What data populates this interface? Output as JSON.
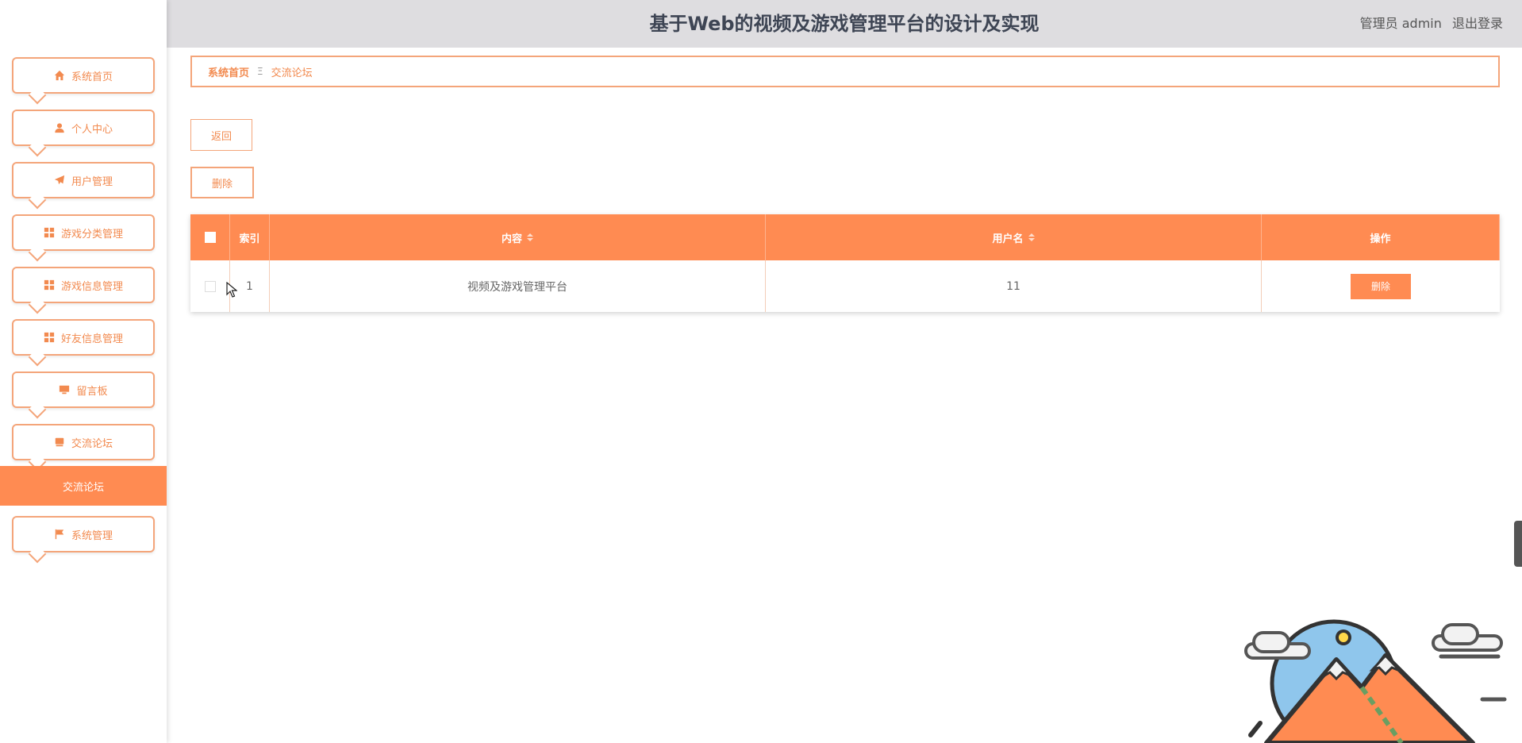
{
  "header": {
    "title": "基于Web的视频及游戏管理平台的设计及实现",
    "user": "管理员 admin",
    "logout": "退出登录"
  },
  "sidebar": {
    "items": [
      {
        "label": "系统首页",
        "icon": "home-icon"
      },
      {
        "label": "个人中心",
        "icon": "person-icon"
      },
      {
        "label": "用户管理",
        "icon": "paper-plane-icon"
      },
      {
        "label": "游戏分类管理",
        "icon": "grid-icon"
      },
      {
        "label": "游戏信息管理",
        "icon": "grid-icon"
      },
      {
        "label": "好友信息管理",
        "icon": "grid-icon"
      },
      {
        "label": "留言板",
        "icon": "monitor-icon"
      },
      {
        "label": "交流论坛",
        "icon": "forum-icon"
      }
    ],
    "active_sub": "交流论坛",
    "last_item": {
      "label": "系统管理",
      "icon": "flag-icon"
    }
  },
  "breadcrumb": {
    "home": "系统首页",
    "separator": "Ξ",
    "current": "交流论坛"
  },
  "buttons": {
    "back": "返回",
    "delete": "删除"
  },
  "table": {
    "columns": [
      "索引",
      "内容",
      "用户名",
      "操作"
    ],
    "rows": [
      {
        "index": "1",
        "content": "视频及游戏管理平台",
        "username": "11",
        "action": "删除"
      }
    ]
  },
  "colors": {
    "accent": "#ff8b52",
    "border": "#f4a57a",
    "header_bg": "#dedde0"
  }
}
